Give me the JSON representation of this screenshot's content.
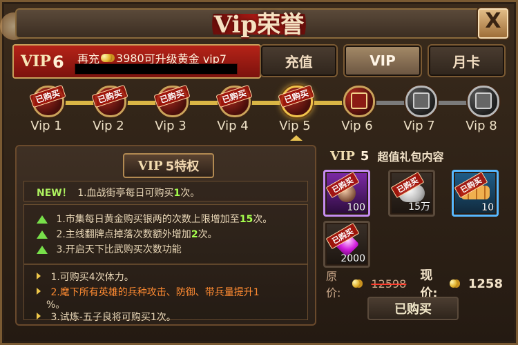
{
  "window": {
    "title": "Vip荣誉",
    "close_label": "X"
  },
  "header": {
    "vip_label": "VIP",
    "vip_level": "6",
    "recharge_prefix": "再充",
    "recharge_amount": "3980",
    "recharge_suffix": "可升级黄金 vip7",
    "progress_fraction": 0
  },
  "tabs": [
    {
      "label": "充值",
      "active": false
    },
    {
      "label": "VIP",
      "active": true
    },
    {
      "label": "月卡",
      "active": false
    }
  ],
  "levels": [
    {
      "label": "Vip 1",
      "stamp": "已购买",
      "state": "bought"
    },
    {
      "label": "Vip 2",
      "stamp": "已购买",
      "state": "bought"
    },
    {
      "label": "Vip 3",
      "stamp": "已购买",
      "state": "bought"
    },
    {
      "label": "Vip 4",
      "stamp": "已购买",
      "state": "bought"
    },
    {
      "label": "Vip 5",
      "stamp": "已购买",
      "state": "selected"
    },
    {
      "label": "Vip 6",
      "stamp": "",
      "state": "gift"
    },
    {
      "label": "Vip 7",
      "stamp": "",
      "state": "locked"
    },
    {
      "label": "Vip 8",
      "stamp": "",
      "state": "locked"
    }
  ],
  "privileges": {
    "title_vip": "VIP",
    "title_rest": "5特权",
    "new_tag": "NEW！",
    "line1_prefix": "1.血战街亭每日可购买",
    "line1_num": "1",
    "line1_suffix": "次。",
    "box2": [
      {
        "prefix": "1.市集每日黄金购买银两的次数上限增加至",
        "num": "15",
        "suffix": "次。"
      },
      {
        "prefix": "2.主线翻牌点掉落次数额外增加",
        "num": "2",
        "suffix": "次。"
      },
      {
        "prefix": "3.开启天下比武购买次数功能",
        "num": "",
        "suffix": ""
      }
    ],
    "box3": [
      {
        "text": "1.可购买4次体力。",
        "color": "normal"
      },
      {
        "text": "2.麾下所有英雄的兵种攻击、防御、带兵量提升1",
        "color": "orange"
      },
      {
        "text": "%。",
        "color": "normal"
      },
      {
        "text": "3.试炼-五子良将可购买1次。",
        "color": "normal"
      }
    ]
  },
  "gift": {
    "vip_label": "VIP",
    "vip_level": "5",
    "title": "超值礼包内容",
    "items": [
      {
        "stamp": "已购买",
        "qty": "100",
        "icon": "hero-icon"
      },
      {
        "stamp": "已购买",
        "qty": "15万",
        "icon": "silver-icon"
      },
      {
        "stamp": "已购买",
        "qty": "10",
        "icon": "wood-logs-icon"
      },
      {
        "stamp": "已购买",
        "qty": "2000",
        "icon": "gem-icon"
      }
    ],
    "original_label": "原价:",
    "original_price": "12598",
    "current_label": "现价:",
    "current_price": "1258",
    "button_label": "已购买"
  }
}
